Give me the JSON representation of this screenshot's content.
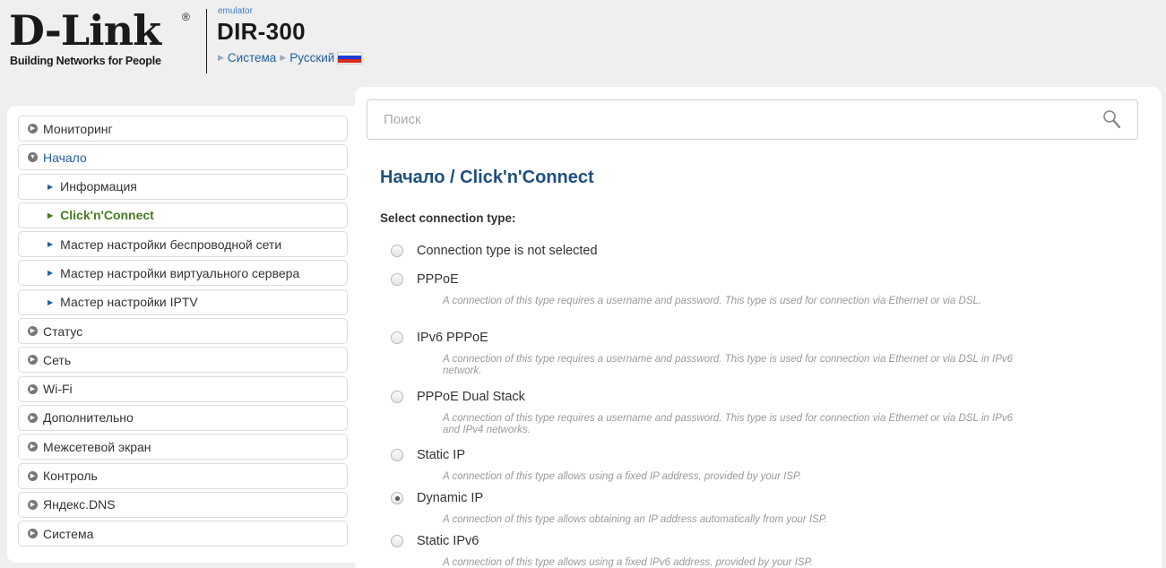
{
  "header": {
    "logo_text": "D-Link",
    "logo_reg": "®",
    "logo_tagline": "Building Networks for People",
    "emulator_label": "emulator",
    "model": "DIR-300",
    "breadcrumb": [
      "Система",
      "Русский"
    ],
    "flag": "russian-flag-icon"
  },
  "search": {
    "placeholder": "Поиск",
    "value": ""
  },
  "sidebar": {
    "items": [
      {
        "label": "Мониторинг",
        "level": 0,
        "icon": "chevron-right-icon"
      },
      {
        "label": "Начало",
        "level": 0,
        "icon": "chevron-down-icon",
        "expanded": true
      },
      {
        "label": "Информация",
        "level": 1
      },
      {
        "label": "Click'n'Connect",
        "level": 1,
        "current": true
      },
      {
        "label": "Мастер настройки беспроводной сети",
        "level": 1
      },
      {
        "label": "Мастер настройки виртуального сервера",
        "level": 1
      },
      {
        "label": "Мастер настройки IPTV",
        "level": 1
      },
      {
        "label": "Статус",
        "level": 0,
        "icon": "chevron-right-icon"
      },
      {
        "label": "Сеть",
        "level": 0,
        "icon": "chevron-right-icon"
      },
      {
        "label": "Wi-Fi",
        "level": 0,
        "icon": "chevron-right-icon"
      },
      {
        "label": "Дополнительно",
        "level": 0,
        "icon": "chevron-right-icon"
      },
      {
        "label": "Межсетевой экран",
        "level": 0,
        "icon": "chevron-right-icon"
      },
      {
        "label": "Контроль",
        "level": 0,
        "icon": "chevron-right-icon"
      },
      {
        "label": "Яндекс.DNS",
        "level": 0,
        "icon": "chevron-right-icon"
      },
      {
        "label": "Система",
        "level": 0,
        "icon": "chevron-right-icon"
      }
    ]
  },
  "main": {
    "title_prefix": "Начало /",
    "title": "Click'n'Connect",
    "section_label": "Select connection type:",
    "options": [
      {
        "label": "Connection type is not selected",
        "desc": "",
        "selected": false
      },
      {
        "label": "PPPoE",
        "desc": "A connection of this type requires a username and password. This type is used for connection via Ethernet or via DSL.",
        "selected": false
      },
      {
        "label": "IPv6 PPPoE",
        "desc": "A connection of this type requires a username and password. This type is used for connection via Ethernet or via DSL in IPv6 network.",
        "selected": false
      },
      {
        "label": "PPPoE Dual Stack",
        "desc": "A connection of this type requires a username and password. This type is used for connection via Ethernet or via DSL in IPv6 and IPv4 networks.",
        "selected": false
      },
      {
        "label": "Static IP",
        "desc": "A connection of this type allows using a fixed IP address, provided by your ISP.",
        "selected": false
      },
      {
        "label": "Dynamic IP",
        "desc": "A connection of this type allows obtaining an IP address automatically from your ISP.",
        "selected": true
      },
      {
        "label": "Static IPv6",
        "desc": "A connection of this type allows using a fixed IPv6 address, provided by your ISP.",
        "selected": false
      }
    ]
  },
  "colors": {
    "title": "#1f4f7f",
    "link": "#1f5f9f",
    "current": "#4a7b1f",
    "desc": "#9a9a9a"
  }
}
